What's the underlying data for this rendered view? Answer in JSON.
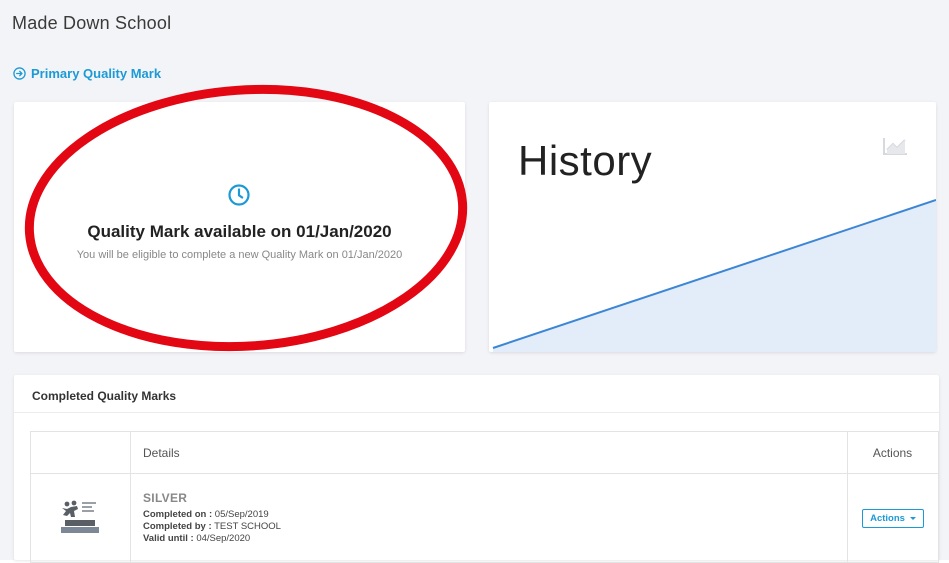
{
  "header": {
    "school_name": "Made Down School",
    "section_link": "Primary Quality Mark"
  },
  "availability_card": {
    "icon": "clock-icon",
    "title": "Quality Mark available on 01/Jan/2020",
    "subtitle": "You will be eligible to complete a new Quality Mark on 01/Jan/2020"
  },
  "history_card": {
    "title": "History",
    "icon": "chart-line-icon"
  },
  "completed": {
    "title": "Completed Quality Marks",
    "columns": [
      "",
      "Details",
      "Actions"
    ],
    "rows": [
      {
        "logo": "youth-sport-trust-silver-logo",
        "level": "SILVER",
        "completed_on_label": "Completed on :",
        "completed_on": "05/Sep/2019",
        "completed_by_label": "Completed by :",
        "completed_by": "TEST SCHOOL",
        "valid_until_label": "Valid until :",
        "valid_until": "04/Sep/2020",
        "action_label": "Actions"
      }
    ]
  },
  "colors": {
    "accent": "#1c9ad6",
    "chart_line": "#3d86d6",
    "chart_fill": "#e3edf9",
    "annotation": "#e30613"
  }
}
